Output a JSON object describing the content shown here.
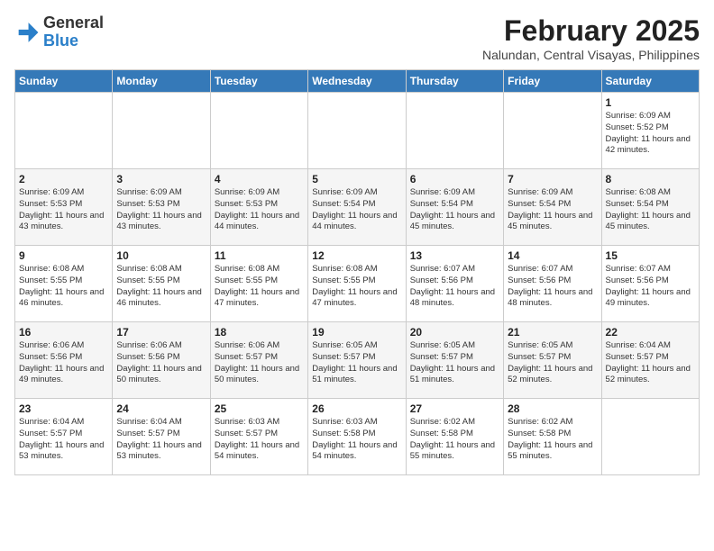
{
  "header": {
    "logo_general": "General",
    "logo_blue": "Blue",
    "month_year": "February 2025",
    "location": "Nalundan, Central Visayas, Philippines"
  },
  "weekdays": [
    "Sunday",
    "Monday",
    "Tuesday",
    "Wednesday",
    "Thursday",
    "Friday",
    "Saturday"
  ],
  "weeks": [
    [
      {
        "day": "",
        "info": ""
      },
      {
        "day": "",
        "info": ""
      },
      {
        "day": "",
        "info": ""
      },
      {
        "day": "",
        "info": ""
      },
      {
        "day": "",
        "info": ""
      },
      {
        "day": "",
        "info": ""
      },
      {
        "day": "1",
        "info": "Sunrise: 6:09 AM\nSunset: 5:52 PM\nDaylight: 11 hours and 42 minutes."
      }
    ],
    [
      {
        "day": "2",
        "info": "Sunrise: 6:09 AM\nSunset: 5:53 PM\nDaylight: 11 hours and 43 minutes."
      },
      {
        "day": "3",
        "info": "Sunrise: 6:09 AM\nSunset: 5:53 PM\nDaylight: 11 hours and 43 minutes."
      },
      {
        "day": "4",
        "info": "Sunrise: 6:09 AM\nSunset: 5:53 PM\nDaylight: 11 hours and 44 minutes."
      },
      {
        "day": "5",
        "info": "Sunrise: 6:09 AM\nSunset: 5:54 PM\nDaylight: 11 hours and 44 minutes."
      },
      {
        "day": "6",
        "info": "Sunrise: 6:09 AM\nSunset: 5:54 PM\nDaylight: 11 hours and 45 minutes."
      },
      {
        "day": "7",
        "info": "Sunrise: 6:09 AM\nSunset: 5:54 PM\nDaylight: 11 hours and 45 minutes."
      },
      {
        "day": "8",
        "info": "Sunrise: 6:08 AM\nSunset: 5:54 PM\nDaylight: 11 hours and 45 minutes."
      }
    ],
    [
      {
        "day": "9",
        "info": "Sunrise: 6:08 AM\nSunset: 5:55 PM\nDaylight: 11 hours and 46 minutes."
      },
      {
        "day": "10",
        "info": "Sunrise: 6:08 AM\nSunset: 5:55 PM\nDaylight: 11 hours and 46 minutes."
      },
      {
        "day": "11",
        "info": "Sunrise: 6:08 AM\nSunset: 5:55 PM\nDaylight: 11 hours and 47 minutes."
      },
      {
        "day": "12",
        "info": "Sunrise: 6:08 AM\nSunset: 5:55 PM\nDaylight: 11 hours and 47 minutes."
      },
      {
        "day": "13",
        "info": "Sunrise: 6:07 AM\nSunset: 5:56 PM\nDaylight: 11 hours and 48 minutes."
      },
      {
        "day": "14",
        "info": "Sunrise: 6:07 AM\nSunset: 5:56 PM\nDaylight: 11 hours and 48 minutes."
      },
      {
        "day": "15",
        "info": "Sunrise: 6:07 AM\nSunset: 5:56 PM\nDaylight: 11 hours and 49 minutes."
      }
    ],
    [
      {
        "day": "16",
        "info": "Sunrise: 6:06 AM\nSunset: 5:56 PM\nDaylight: 11 hours and 49 minutes."
      },
      {
        "day": "17",
        "info": "Sunrise: 6:06 AM\nSunset: 5:56 PM\nDaylight: 11 hours and 50 minutes."
      },
      {
        "day": "18",
        "info": "Sunrise: 6:06 AM\nSunset: 5:57 PM\nDaylight: 11 hours and 50 minutes."
      },
      {
        "day": "19",
        "info": "Sunrise: 6:05 AM\nSunset: 5:57 PM\nDaylight: 11 hours and 51 minutes."
      },
      {
        "day": "20",
        "info": "Sunrise: 6:05 AM\nSunset: 5:57 PM\nDaylight: 11 hours and 51 minutes."
      },
      {
        "day": "21",
        "info": "Sunrise: 6:05 AM\nSunset: 5:57 PM\nDaylight: 11 hours and 52 minutes."
      },
      {
        "day": "22",
        "info": "Sunrise: 6:04 AM\nSunset: 5:57 PM\nDaylight: 11 hours and 52 minutes."
      }
    ],
    [
      {
        "day": "23",
        "info": "Sunrise: 6:04 AM\nSunset: 5:57 PM\nDaylight: 11 hours and 53 minutes."
      },
      {
        "day": "24",
        "info": "Sunrise: 6:04 AM\nSunset: 5:57 PM\nDaylight: 11 hours and 53 minutes."
      },
      {
        "day": "25",
        "info": "Sunrise: 6:03 AM\nSunset: 5:57 PM\nDaylight: 11 hours and 54 minutes."
      },
      {
        "day": "26",
        "info": "Sunrise: 6:03 AM\nSunset: 5:58 PM\nDaylight: 11 hours and 54 minutes."
      },
      {
        "day": "27",
        "info": "Sunrise: 6:02 AM\nSunset: 5:58 PM\nDaylight: 11 hours and 55 minutes."
      },
      {
        "day": "28",
        "info": "Sunrise: 6:02 AM\nSunset: 5:58 PM\nDaylight: 11 hours and 55 minutes."
      },
      {
        "day": "",
        "info": ""
      }
    ]
  ]
}
